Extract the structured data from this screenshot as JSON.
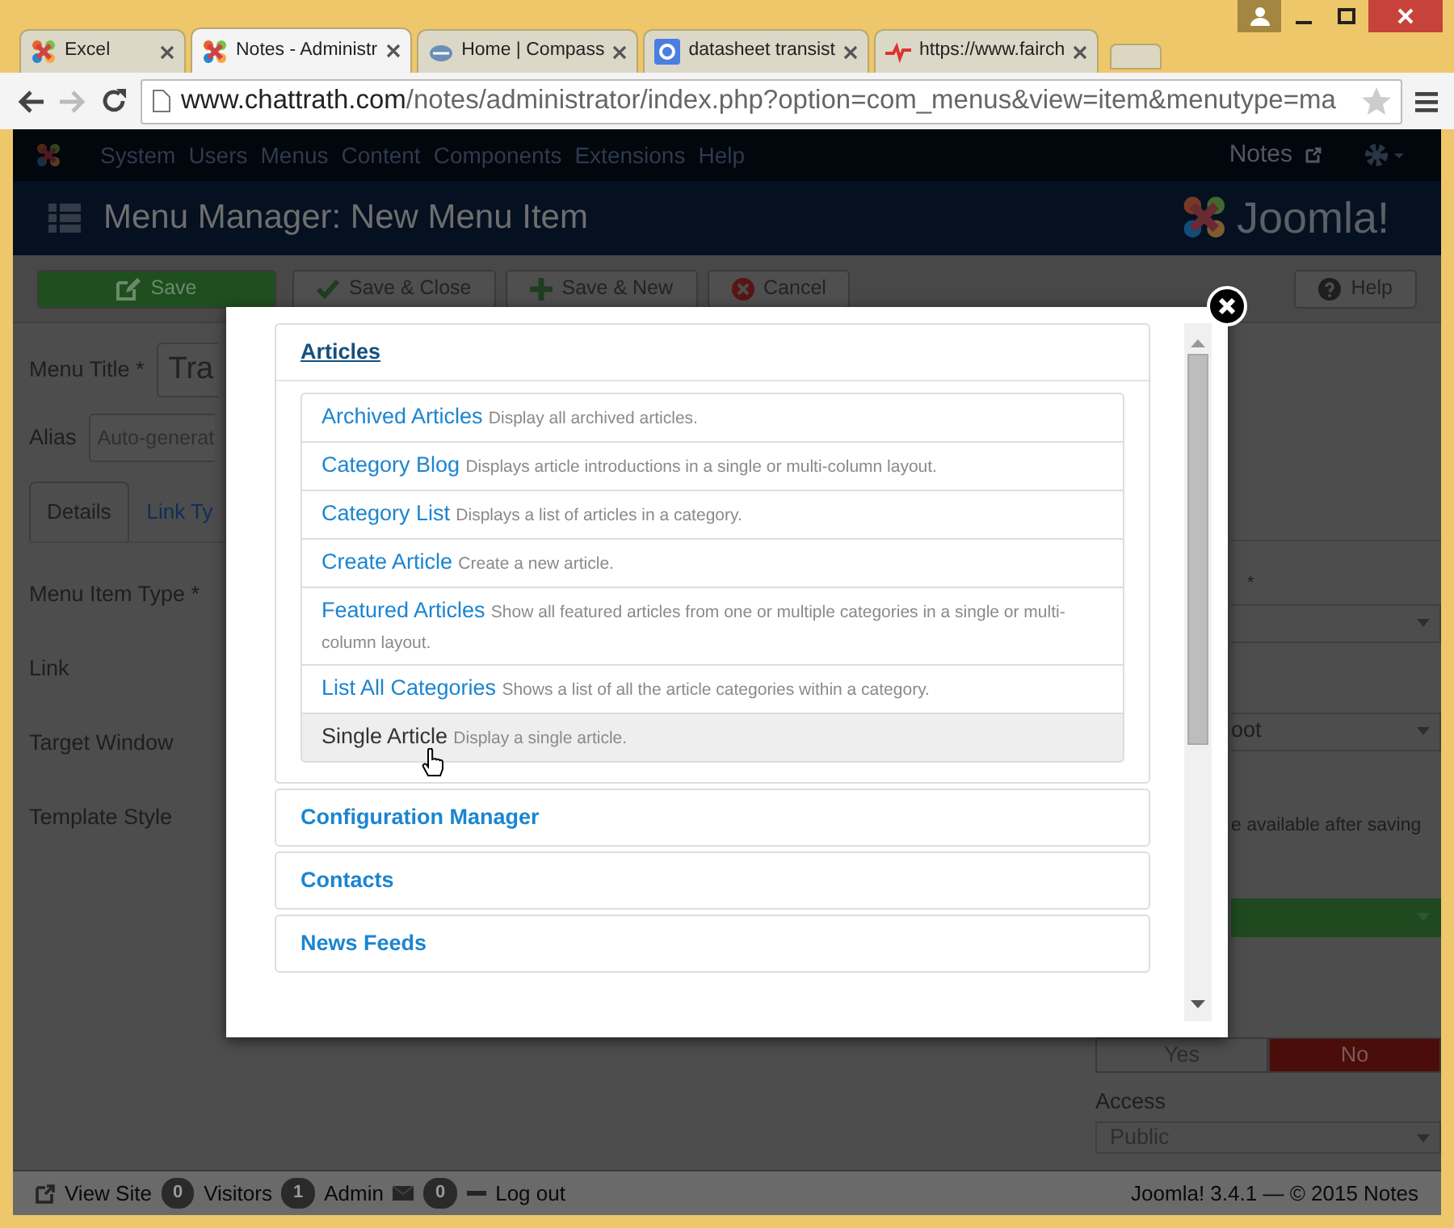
{
  "browser": {
    "tabs": [
      {
        "title": "Excel",
        "kind": "joomla",
        "selected": false
      },
      {
        "title": "Notes - Administr",
        "kind": "joomla",
        "selected": true
      },
      {
        "title": "Home | Compass",
        "kind": "compass",
        "selected": false
      },
      {
        "title": "datasheet transist",
        "kind": "google",
        "selected": false
      },
      {
        "title": "https://www.fairch",
        "kind": "fairchild",
        "selected": false
      }
    ],
    "forward_disabled": true,
    "address": {
      "host": "www.chattrath.com",
      "path": "/notes/administrator/index.php?option=com_menus&view=item&menutype=ma"
    }
  },
  "admin_menu": {
    "items": [
      "System",
      "Users",
      "Menus",
      "Content",
      "Components",
      "Extensions",
      "Help"
    ],
    "site_link": "Notes"
  },
  "header": {
    "title": "Menu Manager: New Menu Item",
    "logo_text": "Joomla!"
  },
  "toolbar": {
    "buttons": [
      {
        "label": "Save",
        "kind": "save"
      },
      {
        "label": "Save & Close",
        "kind": "save-close"
      },
      {
        "label": "Save & New",
        "kind": "save-new"
      },
      {
        "label": "Cancel",
        "kind": "cancel"
      },
      {
        "label": "Help",
        "kind": "help"
      }
    ]
  },
  "form": {
    "title_label": "Menu Title *",
    "title_value": "Tra",
    "alias_label": "Alias",
    "alias_placeholder": "Auto-generat",
    "tabs": [
      {
        "label": "Details",
        "selected": true
      },
      {
        "label": "Link Ty",
        "selected": false
      }
    ],
    "labels": [
      "Menu Item Type *",
      "Link",
      "Target Window",
      "Template Style"
    ]
  },
  "sidebar": {
    "required_mark": "*",
    "parent_value": "oot",
    "note": "e available after saving",
    "toggle": [
      {
        "label": "Yes",
        "selected": false
      },
      {
        "label": "No",
        "selected": true
      }
    ],
    "access_label": "Access",
    "access_value": "Public"
  },
  "modal": {
    "groups": [
      {
        "title": "Articles",
        "expanded": true,
        "items": [
          {
            "title": "Archived Articles",
            "description": "Display all archived articles.",
            "selected": false
          },
          {
            "title": "Category Blog",
            "description": "Displays article introductions in a single or multi-column layout.",
            "selected": false
          },
          {
            "title": "Category List",
            "description": "Displays a list of articles in a category.",
            "selected": false
          },
          {
            "title": "Create Article",
            "description": "Create a new article.",
            "selected": false
          },
          {
            "title": "Featured Articles",
            "description": "Show all featured articles from one or multiple categories in a single or multi-column layout.",
            "selected": false
          },
          {
            "title": "List All Categories",
            "description": "Shows a list of all the article categories within a category.",
            "selected": false
          },
          {
            "title": "Single Article",
            "description": "Display a single article.",
            "selected": true
          }
        ]
      },
      {
        "title": "Configuration Manager",
        "expanded": false
      },
      {
        "title": "Contacts",
        "expanded": false
      },
      {
        "title": "News Feeds",
        "expanded": false
      }
    ]
  },
  "status_bar": {
    "view_site": "View Site",
    "visitors_count": "0",
    "visitors": "Visitors",
    "admin_count": "1",
    "admin": "Admin",
    "messages_count": "0",
    "logout": "Log out",
    "version": "Joomla! 3.4.1 — © 2015 Notes"
  }
}
